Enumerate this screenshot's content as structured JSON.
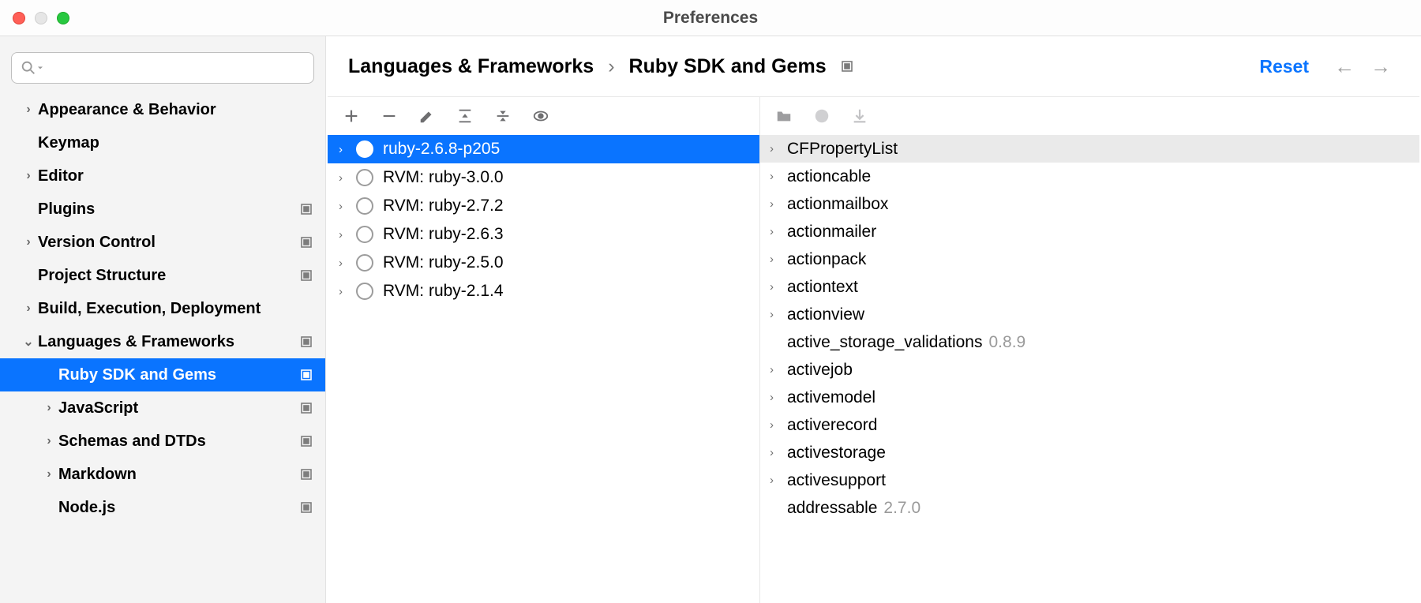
{
  "window": {
    "title": "Preferences"
  },
  "search": {
    "placeholder": ""
  },
  "reset_label": "Reset",
  "breadcrumbs": [
    "Languages & Frameworks",
    "Ruby SDK and Gems"
  ],
  "sidebar": [
    {
      "label": "Appearance & Behavior",
      "level": 0,
      "expandable": true,
      "arrow": "right",
      "icon": false,
      "selected": false
    },
    {
      "label": "Keymap",
      "level": 0,
      "expandable": false,
      "arrow": "",
      "icon": false,
      "selected": false
    },
    {
      "label": "Editor",
      "level": 0,
      "expandable": true,
      "arrow": "right",
      "icon": false,
      "selected": false
    },
    {
      "label": "Plugins",
      "level": 0,
      "expandable": false,
      "arrow": "",
      "icon": true,
      "selected": false
    },
    {
      "label": "Version Control",
      "level": 0,
      "expandable": true,
      "arrow": "right",
      "icon": true,
      "selected": false
    },
    {
      "label": "Project Structure",
      "level": 0,
      "expandable": false,
      "arrow": "",
      "icon": true,
      "selected": false
    },
    {
      "label": "Build, Execution, Deployment",
      "level": 0,
      "expandable": true,
      "arrow": "right",
      "icon": false,
      "selected": false
    },
    {
      "label": "Languages & Frameworks",
      "level": 0,
      "expandable": true,
      "arrow": "down",
      "icon": true,
      "selected": false
    },
    {
      "label": "Ruby SDK and Gems",
      "level": 1,
      "expandable": false,
      "arrow": "",
      "icon": true,
      "selected": true
    },
    {
      "label": "JavaScript",
      "level": 1,
      "expandable": true,
      "arrow": "right",
      "icon": true,
      "selected": false
    },
    {
      "label": "Schemas and DTDs",
      "level": 1,
      "expandable": true,
      "arrow": "right",
      "icon": true,
      "selected": false
    },
    {
      "label": "Markdown",
      "level": 1,
      "expandable": true,
      "arrow": "right",
      "icon": true,
      "selected": false
    },
    {
      "label": "Node.js",
      "level": 1,
      "expandable": false,
      "arrow": "",
      "icon": true,
      "selected": false
    }
  ],
  "sdks": [
    {
      "label": "ruby-2.6.8-p205",
      "selected": true,
      "checked": true
    },
    {
      "label": "RVM: ruby-3.0.0",
      "selected": false,
      "checked": false
    },
    {
      "label": "RVM: ruby-2.7.2",
      "selected": false,
      "checked": false
    },
    {
      "label": "RVM: ruby-2.6.3",
      "selected": false,
      "checked": false
    },
    {
      "label": "RVM: ruby-2.5.0",
      "selected": false,
      "checked": false
    },
    {
      "label": "RVM: ruby-2.1.4",
      "selected": false,
      "checked": false
    }
  ],
  "gems": [
    {
      "name": "CFPropertyList",
      "version": "",
      "expandable": true,
      "selected": true
    },
    {
      "name": "actioncable",
      "version": "",
      "expandable": true,
      "selected": false
    },
    {
      "name": "actionmailbox",
      "version": "",
      "expandable": true,
      "selected": false
    },
    {
      "name": "actionmailer",
      "version": "",
      "expandable": true,
      "selected": false
    },
    {
      "name": "actionpack",
      "version": "",
      "expandable": true,
      "selected": false
    },
    {
      "name": "actiontext",
      "version": "",
      "expandable": true,
      "selected": false
    },
    {
      "name": "actionview",
      "version": "",
      "expandable": true,
      "selected": false
    },
    {
      "name": "active_storage_validations",
      "version": "0.8.9",
      "expandable": false,
      "selected": false
    },
    {
      "name": "activejob",
      "version": "",
      "expandable": true,
      "selected": false
    },
    {
      "name": "activemodel",
      "version": "",
      "expandable": true,
      "selected": false
    },
    {
      "name": "activerecord",
      "version": "",
      "expandable": true,
      "selected": false
    },
    {
      "name": "activestorage",
      "version": "",
      "expandable": true,
      "selected": false
    },
    {
      "name": "activesupport",
      "version": "",
      "expandable": true,
      "selected": false
    },
    {
      "name": "addressable",
      "version": "2.7.0",
      "expandable": false,
      "selected": false
    }
  ]
}
